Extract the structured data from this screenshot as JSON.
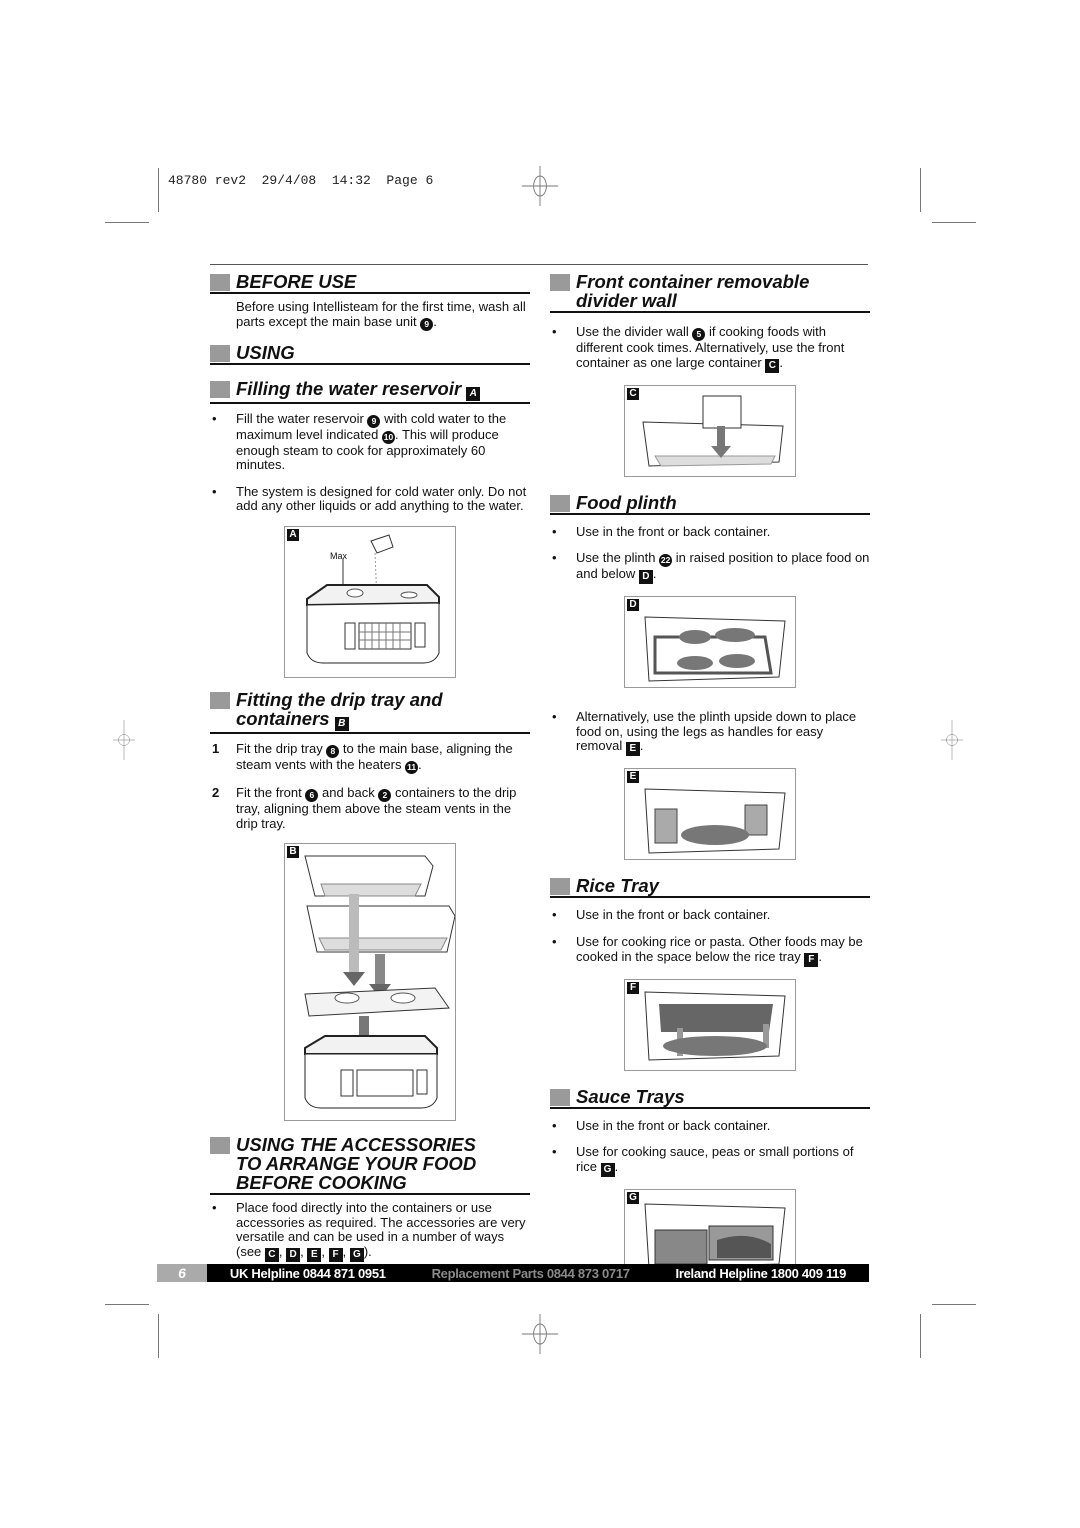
{
  "slug": "48780 rev2  29/4/08  14:32  Page 6",
  "left": {
    "before_use": {
      "title": "BEFORE USE",
      "text_before": "Before using Intellisteam for the first time, wash all parts except the main base unit ",
      "ref": "9",
      "text_after": "."
    },
    "using": {
      "title": "USING"
    },
    "filling": {
      "title": "Filling the water reservoir",
      "fig_ref": "A",
      "bullets": [
        {
          "parts": [
            "Fill the water reservoir ",
            {
              "circle": "9"
            },
            " with cold water to the maximum level indicated ",
            {
              "circle": "10"
            },
            ". This will produce enough steam to cook for approximately 60 minutes."
          ]
        },
        {
          "parts": [
            "The system is designed for cold water only. Do not add any other liquids or add anything to the water."
          ]
        }
      ],
      "figure": {
        "label": "A",
        "annotation": "Max"
      }
    },
    "fitting": {
      "title_line1": "Fitting the drip tray and",
      "title_line2": "containers",
      "fig_ref": "B",
      "steps": [
        {
          "n": "1",
          "parts": [
            "Fit the drip tray ",
            {
              "circle": "8"
            },
            " to the main base, aligning the steam vents with the heaters ",
            {
              "circle": "11"
            },
            "."
          ]
        },
        {
          "n": "2",
          "parts": [
            "Fit the front ",
            {
              "circle": "6"
            },
            " and back ",
            {
              "circle": "2"
            },
            " containers to the drip tray, aligning them above the steam vents in the drip tray."
          ]
        }
      ],
      "figure": {
        "label": "B"
      }
    },
    "accessories": {
      "title_lines": [
        "USING THE ACCESSORIES",
        "TO ARRANGE YOUR FOOD",
        "BEFORE COOKING"
      ],
      "bullet_parts": [
        "Place food directly into the containers or use accessories as required. The accessories are very versatile and can be used in a number of ways (see ",
        {
          "box": "C"
        },
        ", ",
        {
          "box": "D"
        },
        ", ",
        {
          "box": "E"
        },
        ", ",
        {
          "box": "F"
        },
        ", ",
        {
          "box": "G"
        },
        ")."
      ]
    }
  },
  "right": {
    "divider": {
      "title_line1": "Front container removable",
      "title_line2": "divider wall",
      "bullets": [
        {
          "parts": [
            "Use the divider wall ",
            {
              "circle": "5"
            },
            " if cooking foods with different cook times. Alternatively, use the front container as one large container ",
            {
              "box": "C"
            },
            "."
          ]
        }
      ],
      "figure": {
        "label": "C"
      }
    },
    "plinth": {
      "title": "Food plinth",
      "bullets": [
        {
          "parts": [
            "Use in the front or back container."
          ]
        },
        {
          "parts": [
            "Use the plinth ",
            {
              "circle": "22"
            },
            " in raised position to place food on and below ",
            {
              "box": "D"
            },
            "."
          ]
        }
      ],
      "figure_d": {
        "label": "D"
      },
      "bullets2": [
        {
          "parts": [
            "Alternatively, use the plinth upside down to place food on, using the legs as handles for easy removal ",
            {
              "box": "E"
            },
            "."
          ]
        }
      ],
      "figure_e": {
        "label": "E"
      }
    },
    "rice": {
      "title": "Rice Tray",
      "bullets": [
        {
          "parts": [
            "Use in the front or back container."
          ]
        },
        {
          "parts": [
            "Use for cooking rice or pasta. Other foods may be cooked in the space below the rice tray ",
            {
              "box": "F"
            },
            "."
          ]
        }
      ],
      "figure": {
        "label": "F"
      }
    },
    "sauce": {
      "title": "Sauce Trays",
      "bullets": [
        {
          "parts": [
            "Use in the front or back container."
          ]
        },
        {
          "parts": [
            "Use for cooking sauce, peas or small portions of rice ",
            {
              "box": "G"
            },
            "."
          ]
        }
      ],
      "figure": {
        "label": "G"
      }
    }
  },
  "footer": {
    "page_number": "6",
    "uk_helpline": "UK Helpline 0844 871 0951",
    "replacement_parts": "Replacement Parts 0844 873 0717",
    "ireland_helpline": "Ireland Helpline 1800 409 119"
  }
}
